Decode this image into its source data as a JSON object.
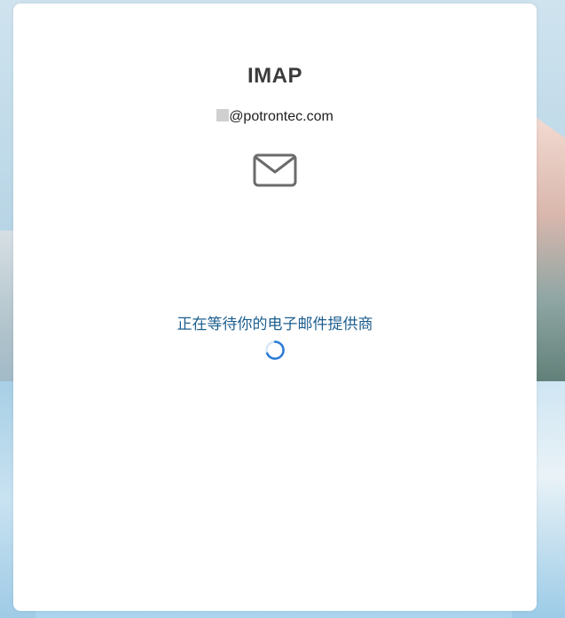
{
  "dialog": {
    "title": "IMAP",
    "account_suffix": "@potrontec.com",
    "status_text": "正在等待你的电子邮件提供商"
  },
  "icons": {
    "mail": "mail-envelope-icon",
    "spinner": "loading-spinner-icon"
  },
  "colors": {
    "status_text": "#1c5e8f",
    "spinner": "#2b7bd6",
    "card": "#ffffff"
  }
}
